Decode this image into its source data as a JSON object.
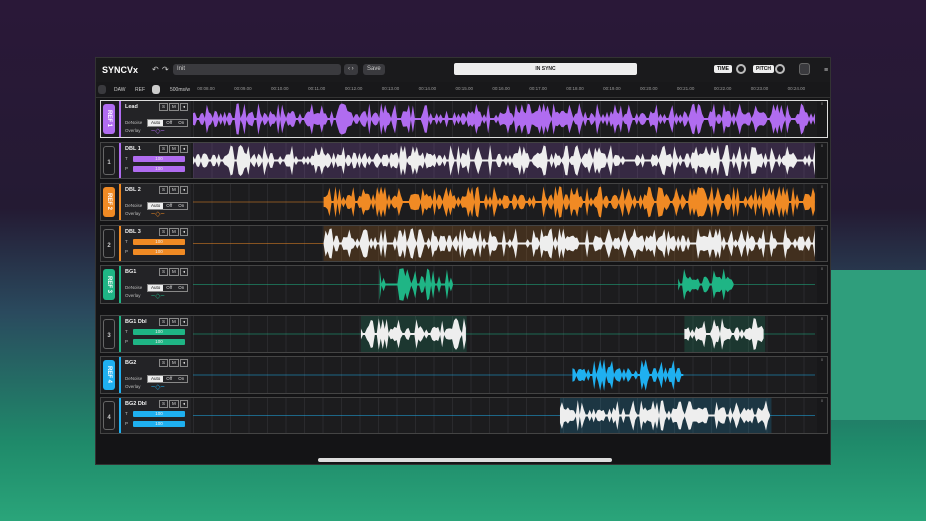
{
  "app": {
    "name": "SYNCVx",
    "preset": "Init",
    "save": "Save",
    "status": "IN SYNC",
    "time": "TIME",
    "pitch": "PITCH"
  },
  "toolbar": {
    "draw": "DAW",
    "ref": "REF",
    "zoom": "500ms/w"
  },
  "ruler": [
    "00:08.00",
    "00:09.00",
    "00:10.00",
    "00:11.00",
    "00:12.00",
    "00:13.00",
    "00:14.00",
    "00:15.00",
    "00:16.00",
    "00:17.00",
    "00:18.00",
    "00:19.00",
    "00:20.00",
    "00:21.00",
    "00:22.00",
    "00:23.00",
    "00:24.00"
  ],
  "labels": {
    "s": "S",
    "m": "M",
    "denoise": "DeNoise",
    "overlay": "Overlay",
    "auto": "Auto",
    "off": "Off",
    "on": "On",
    "t": "T",
    "p": "P",
    "meter_top": "0"
  },
  "tracks": [
    {
      "name": "Lead",
      "type": "ref",
      "tab": "REF 1",
      "color": "#b06cf0"
    },
    {
      "name": "DBL 1",
      "type": "dbl",
      "tab": "1",
      "color": "#b06cf0",
      "t": "100",
      "p": "100"
    },
    {
      "name": "DBL 2",
      "type": "ref",
      "tab": "REF 2",
      "color": "#f08a24"
    },
    {
      "name": "DBL 3",
      "type": "dbl",
      "tab": "2",
      "color": "#f08a24",
      "t": "100",
      "p": "100"
    },
    {
      "name": "BG1",
      "type": "ref",
      "tab": "REF 3",
      "color": "#1fb585"
    },
    {
      "name": "BG1 Dbl",
      "type": "dbl",
      "tab": "3",
      "color": "#1fb585",
      "t": "100",
      "p": "100"
    },
    {
      "name": "BG2",
      "type": "ref",
      "tab": "REF 4",
      "color": "#1fb0f0"
    },
    {
      "name": "BG2 Dbl",
      "type": "dbl",
      "tab": "4",
      "color": "#1fb0f0",
      "t": "100",
      "p": "100"
    }
  ]
}
